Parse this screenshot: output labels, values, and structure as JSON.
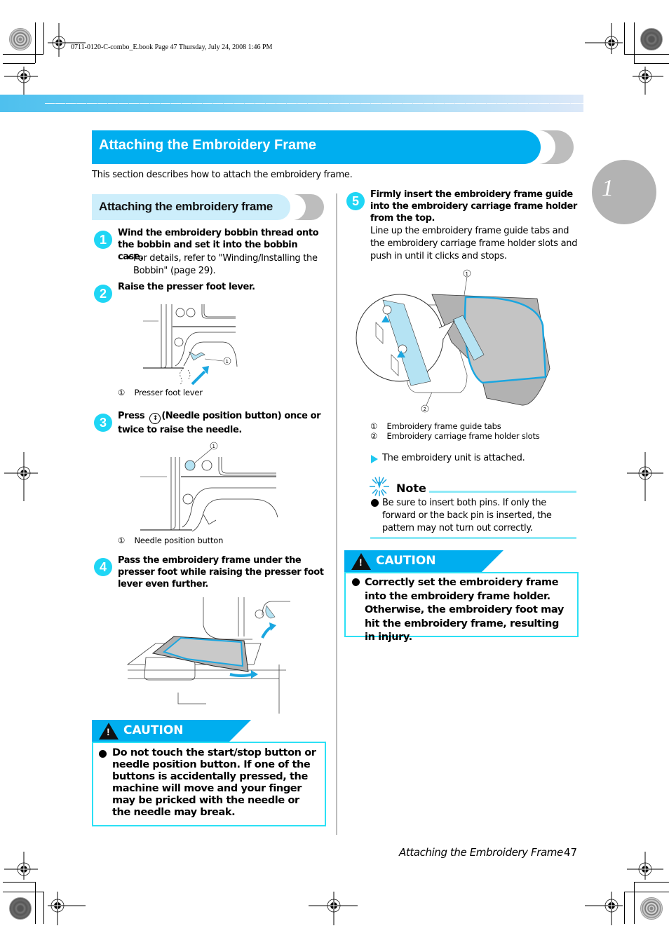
{
  "print_info": "0711-0120-C-combo_E.book  Page 47  Thursday, July 24, 2008  1:46 PM",
  "chapter_number": "1",
  "title": "Attaching the Embroidery Frame",
  "intro": "This section describes how to attach the embroidery frame.",
  "subsection_title": "Attaching the embroidery frame",
  "steps": [
    {
      "num": "1",
      "heading": "Wind the embroidery bobbin thread onto the bobbin and set it into the bobbin case.",
      "bullet": "For details, refer to \"Winding/Installing the Bobbin\" (page 29)."
    },
    {
      "num": "2",
      "heading": "Raise the presser foot lever.",
      "callout": "①",
      "caption_num": "①",
      "caption": "Presser foot lever"
    },
    {
      "num": "3",
      "heading_pre": "Press",
      "heading_icon": "needle-position-icon",
      "heading_post": "(Needle position button) once or twice to raise the needle.",
      "callout": "①",
      "caption_num": "①",
      "caption": "Needle position button"
    },
    {
      "num": "4",
      "heading": "Pass the embroidery frame under the presser foot while raising the presser foot lever even further."
    },
    {
      "num": "5",
      "heading": "Firmly insert the embroidery frame guide into the embroidery carriage frame holder from the top.",
      "body": "Line up the embroidery frame guide tabs and the embroidery carriage frame holder slots and push in until it clicks and stops.",
      "callouts": [
        "①",
        "②"
      ],
      "captions": [
        {
          "num": "①",
          "text": "Embroidery frame guide tabs"
        },
        {
          "num": "②",
          "text": "Embroidery carriage frame holder slots"
        }
      ],
      "result": "The embroidery unit is attached."
    }
  ],
  "caution_left": {
    "label": "CAUTION",
    "text": "Do not touch the start/stop button or needle position button. If one of the buttons is accidentally pressed, the machine will move and your finger may be pricked with the needle or the needle may break."
  },
  "note": {
    "label": "Note",
    "text": "Be sure to insert both pins. If only the forward or the back pin is inserted, the pattern may not turn out correctly."
  },
  "caution_right": {
    "label": "CAUTION",
    "text": "Correctly set the embroidery frame into the embroidery frame holder. Otherwise, the embroidery foot may hit the embroidery frame, resulting in injury."
  },
  "footer": {
    "title": "Attaching the Embroidery Frame",
    "page": "47"
  },
  "colors": {
    "accent": "#00aeef",
    "step_badge": "#1fd6f5",
    "caution_border": "#2be0f5",
    "subsection_bg": "#cdeefb",
    "chapter_circle": "#b3b3b3"
  }
}
